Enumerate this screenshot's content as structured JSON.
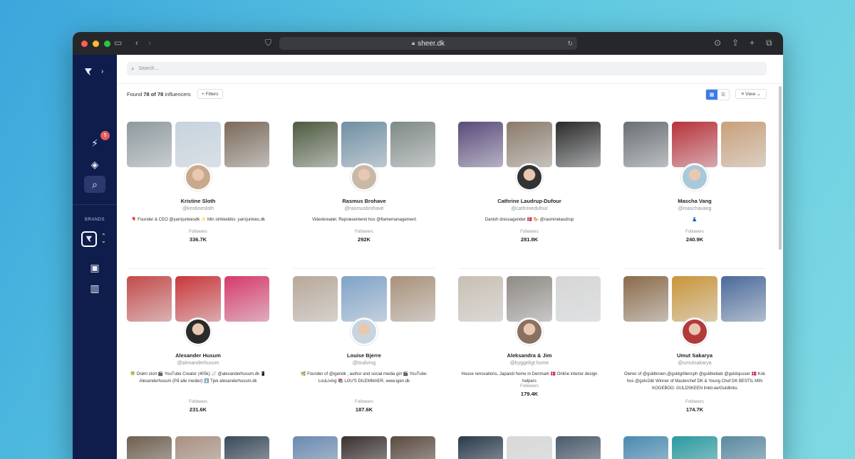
{
  "browser": {
    "url": "sheer.dk"
  },
  "sidebar": {
    "notification_count": "5",
    "brands_label": "BRANDS"
  },
  "search": {
    "placeholder": "Search..."
  },
  "results": {
    "prefix": "Found",
    "count": "78 of 78",
    "suffix": "influencers",
    "filters_label": "Filters",
    "view_label": "View"
  },
  "followers_label": "Followers",
  "influencers": [
    {
      "name": "Kristine Sloth",
      "handle": "@kristinesloth",
      "bio": "🎈 Founder & CEO @yarnjunkiesdk ✨ Min strikkebiks: yarnjunkies.dk",
      "followers": "336.7K",
      "colors": [
        "#8f9a9e",
        "#c6d3de",
        "#7a6a5a",
        "#c9a98c"
      ]
    },
    {
      "name": "Rasmus Brohave",
      "handle": "@rasmusbrohave",
      "bio": "Videokreatør, Repræsenteret hos @flamemanagement",
      "followers": "292K",
      "colors": [
        "#4d5a3e",
        "#6f8fa3",
        "#7f8a86",
        "#c9b8a8"
      ]
    },
    {
      "name": "Cathrine Laudrup-Dufour",
      "handle": "@cathrinedufour",
      "bio": "Danish dressagerider 🇩🇰 🐎 @rasminelaudrup",
      "followers": "281.8K",
      "colors": [
        "#5a4a7a",
        "#8a7a6a",
        "#2a2a2a",
        "#333"
      ]
    },
    {
      "name": "Mascha Vang",
      "handle": "@maschavang",
      "bio": "👗",
      "followers": "240.9K",
      "colors": [
        "#6a6f74",
        "#b8323a",
        "#c9a07a",
        "#a8c8dc"
      ]
    },
    {
      "name": "Alexander Husum",
      "handle": "@alexanderhusum",
      "bio": "🍀 Drøm stort 🎬 YouTube Creator (405k) 📈 @alexanderhusum.dk 📱 Alexanderhusum (På alle medier) ⬇️ Tjek alexanderhusum.dk",
      "followers": "231.6K",
      "colors": [
        "#c44a4a",
        "#c9363a",
        "#d63a6a",
        "#2a2a2a"
      ]
    },
    {
      "name": "Louise Bjerre",
      "handle": "@louliving",
      "bio": "🌿 Founder of @igendk , author and social media girl 🎬 YouTube: LouLiving 📚 LOU'S DILEMMAER, www.igen.dk",
      "followers": "187.6K",
      "colors": [
        "#b8a898",
        "#7fa3c8",
        "#a8917a",
        "#c8d4e0"
      ]
    },
    {
      "name": "Aleksandra & Jim",
      "handle": "@byggeligt.home",
      "bio": "House renovations, Japandi home in Denmark 🇩🇰 Online interior design helpers",
      "followers": "179.4K",
      "colors": [
        "#c9bfb3",
        "#8f8a84",
        "#d6d6d6",
        "#8a7060"
      ]
    },
    {
      "name": "Umut Sakarya",
      "handle": "@umutsakarya",
      "bio": "Owner of @guldkroen,@guldgrillencph @guldkebab @guldsjusser 🇩🇰 Kok hos @gotv2dk Winner of Masterchef DK & Young Chef DK BESTIL MIN KOGEBOG: GULDSKEEN linktr.ee/Guldlinks",
      "followers": "174.7K",
      "colors": [
        "#8a6a4a",
        "#c9953a",
        "#4a6a9a",
        "#b23a3a"
      ]
    }
  ],
  "third_row_colors": [
    [
      "#6f6050",
      "#a89080",
      "#3a4a5a"
    ],
    [
      "#6a8ab0",
      "#3a3030",
      "#5a4a40"
    ],
    [
      "#2a3a4a",
      "#d8d8d8",
      "#4a5a6a"
    ],
    [
      "#4a8ab0",
      "#2a9aa0",
      "#5a8aa0"
    ]
  ]
}
